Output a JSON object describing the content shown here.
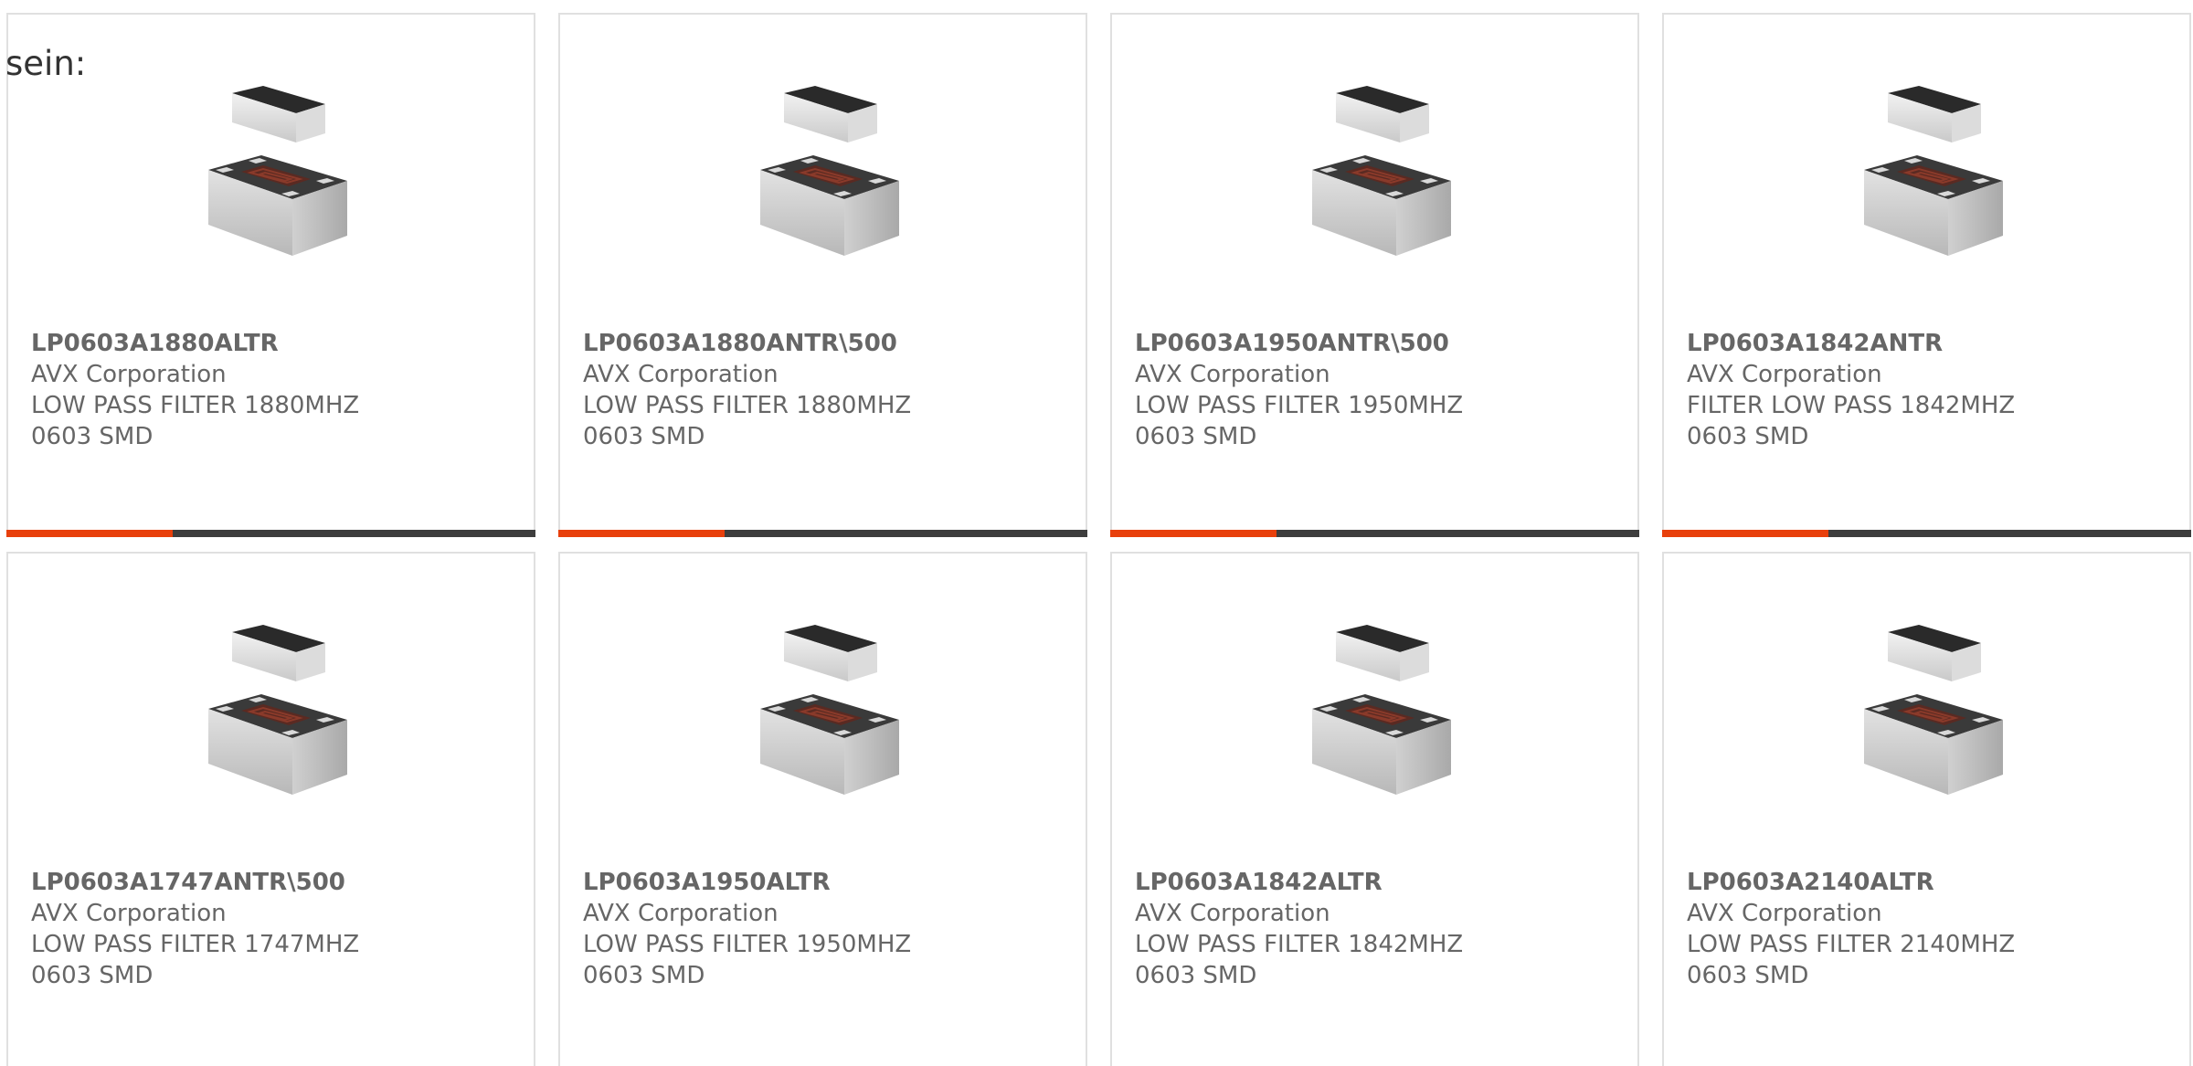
{
  "intro_text": "sein:",
  "colors": {
    "accent": "#e8400c",
    "bar_dark": "#3d3d3d",
    "text": "#666666",
    "border": "#e0e0e0"
  },
  "products": [
    {
      "part": "LP0603A1880ALTR",
      "manufacturer": "AVX Corporation",
      "description": "LOW PASS FILTER 1880MHZ",
      "package": "0603 SMD",
      "image_icon": "smd-filter-component-icon"
    },
    {
      "part": "LP0603A1880ANTR\\500",
      "manufacturer": "AVX Corporation",
      "description": "LOW PASS FILTER 1880MHZ",
      "package": "0603 SMD",
      "image_icon": "smd-filter-component-icon"
    },
    {
      "part": "LP0603A1950ANTR\\500",
      "manufacturer": "AVX Corporation",
      "description": "LOW PASS FILTER 1950MHZ",
      "package": "0603 SMD",
      "image_icon": "smd-filter-component-icon"
    },
    {
      "part": "LP0603A1842ANTR",
      "manufacturer": "AVX Corporation",
      "description": "FILTER LOW PASS 1842MHZ",
      "package": "0603 SMD",
      "image_icon": "smd-filter-component-icon"
    },
    {
      "part": "LP0603A1747ANTR\\500",
      "manufacturer": "AVX Corporation",
      "description": "LOW PASS FILTER 1747MHZ",
      "package": "0603 SMD",
      "image_icon": "smd-filter-component-icon"
    },
    {
      "part": "LP0603A1950ALTR",
      "manufacturer": "AVX Corporation",
      "description": "LOW PASS FILTER 1950MHZ",
      "package": "0603 SMD",
      "image_icon": "smd-filter-component-icon"
    },
    {
      "part": "LP0603A1842ALTR",
      "manufacturer": "AVX Corporation",
      "description": "LOW PASS FILTER 1842MHZ",
      "package": "0603 SMD",
      "image_icon": "smd-filter-component-icon"
    },
    {
      "part": "LP0603A2140ALTR",
      "manufacturer": "AVX Corporation",
      "description": "LOW PASS FILTER 2140MHZ",
      "package": "0603 SMD",
      "image_icon": "smd-filter-component-icon"
    }
  ]
}
